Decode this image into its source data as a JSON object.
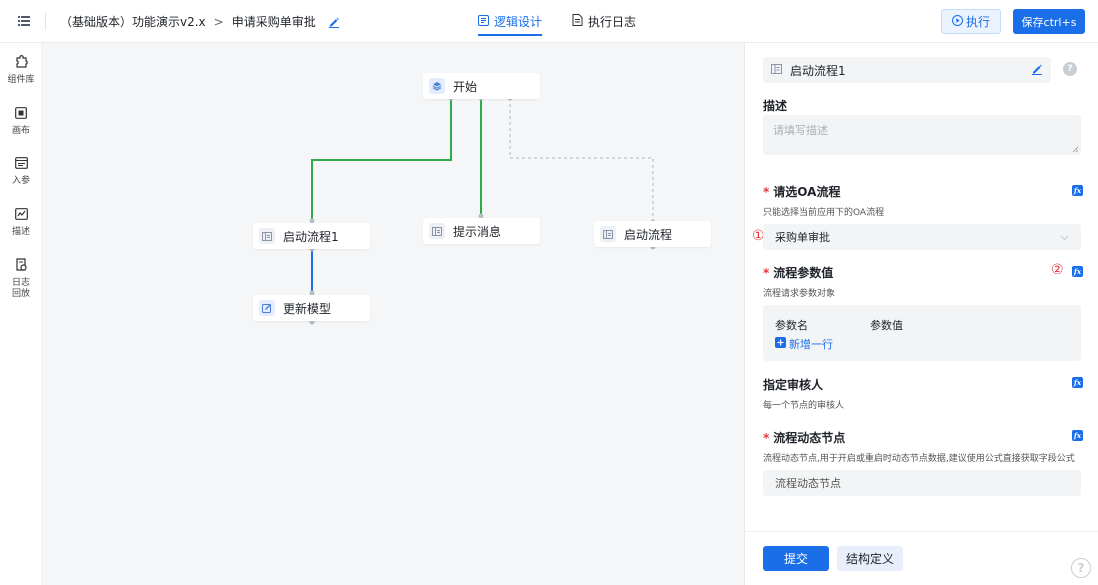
{
  "header": {
    "app_name": "（基础版本）功能演示v2.x",
    "breadcrumb_sep": ">",
    "page_name": "申请采购单审批",
    "tabs": [
      {
        "label": "逻辑设计",
        "icon": "logic-design-icon",
        "active": true
      },
      {
        "label": "执行日志",
        "icon": "execution-log-icon",
        "active": false
      }
    ],
    "run_label": "执行",
    "save_label": "保存ctrl+s"
  },
  "rail": {
    "items": [
      {
        "label": "组件库",
        "icon": "puzzle-icon"
      },
      {
        "label": "画布",
        "icon": "canvas-icon"
      },
      {
        "label": "入参",
        "icon": "input-params-icon"
      },
      {
        "label": "描述",
        "icon": "description-icon"
      },
      {
        "label": "日志回放",
        "icon": "log-replay-icon"
      }
    ]
  },
  "canvas": {
    "nodes": [
      {
        "label": "开始",
        "icon": "start-layers-icon"
      },
      {
        "label": "启动流程1",
        "icon": "workflow-icon"
      },
      {
        "label": "提示消息",
        "icon": "message-icon"
      },
      {
        "label": "启动流程",
        "icon": "workflow-icon"
      },
      {
        "label": "更新模型",
        "icon": "update-model-icon"
      }
    ],
    "colors": {
      "success_wire": "#2eab48",
      "active_wire": "#1a6fe8",
      "idle_wire": "#c0c4cc"
    }
  },
  "panel": {
    "node_title": "启动流程1",
    "help": "?",
    "description": {
      "label": "描述",
      "placeholder": "请填写描述"
    },
    "oa_flow": {
      "required": "*",
      "label": "请选OA流程",
      "hint": "只能选择当前应用下的OA流程",
      "marker": "①",
      "value": "采购单审批"
    },
    "params": {
      "required": "*",
      "label": "流程参数值",
      "hint": "流程请求参数对象",
      "marker": "②",
      "col_name": "参数名",
      "col_value": "参数值",
      "add_row": "新增一行"
    },
    "approver": {
      "label": "指定审核人",
      "hint": "每一个节点的审核人"
    },
    "dynamic_node": {
      "required": "*",
      "label": "流程动态节点",
      "hint": "流程动态节点,用于开启或重启时动态节点数据,建议使用公式直接获取字段公式",
      "placeholder": "流程动态节点"
    },
    "fx": "fx",
    "submit_label": "提交",
    "struct_label": "结构定义",
    "corner_help": "?"
  },
  "colors": {
    "accent": "#1a6fe8",
    "required": "#e5383b"
  }
}
